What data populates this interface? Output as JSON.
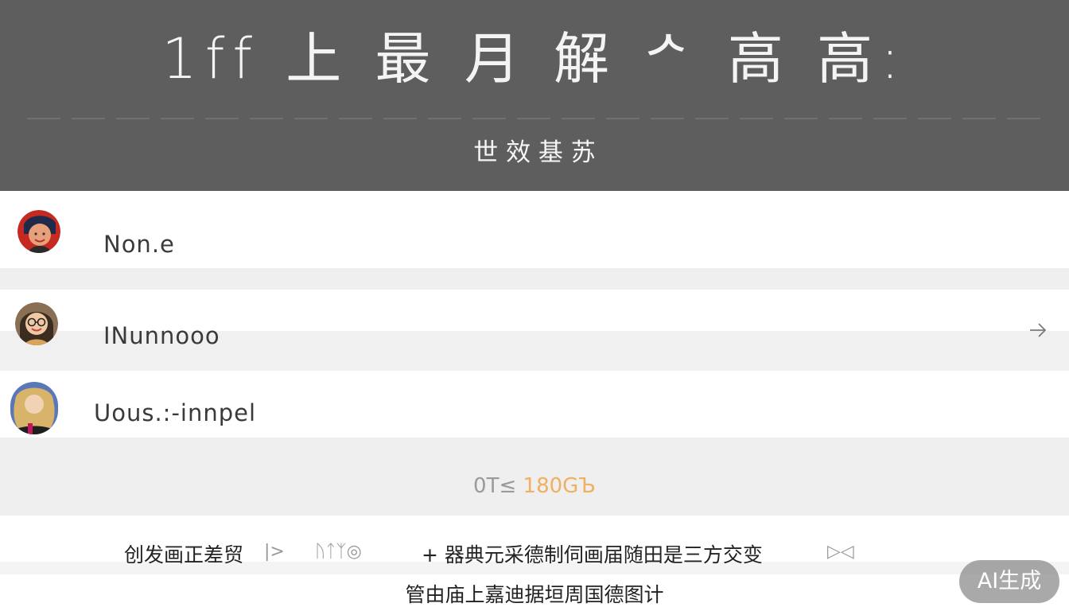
{
  "header": {
    "title": "1ff 上 最 月 解 ᄼ 高 高:",
    "subtitle": "世 效 基 苏"
  },
  "list": {
    "items": [
      {
        "label": "Non.e",
        "avatar_icon": "person-avatar-icon"
      },
      {
        "label": "INunnooo",
        "avatar_icon": "person-avatar-icon",
        "chevron_icon": "chevron-right-icon"
      },
      {
        "label": "Uous.:-innpel",
        "avatar_icon": "person-avatar-icon"
      }
    ]
  },
  "status": {
    "prefix": "0T≤",
    "value": "180GЪ"
  },
  "footer": {
    "links": [
      "创发画正差贸",
      "|>",
      "ᚢᛏᛉ◎",
      "+ 器典元采德制伺画届随田是三方交变",
      "▷◁"
    ],
    "notice": "管由庙上嘉迪据垣周国德图计"
  },
  "badge": {
    "label": "AI生成"
  },
  "colors": {
    "header_bg": "#5e5e5e",
    "status_value": "#f0b060",
    "band_bg": "#efeff0"
  }
}
